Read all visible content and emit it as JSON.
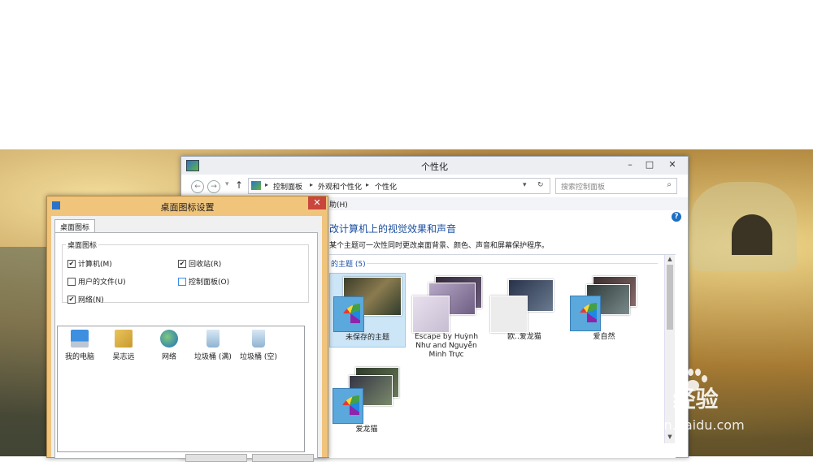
{
  "main_window": {
    "title": "个性化",
    "controls": [
      "–",
      "□",
      "✕"
    ],
    "nav": {
      "back": "←",
      "forward": "→",
      "recent": "▾",
      "up": "↑"
    },
    "breadcrumb": [
      "控制面板",
      "外观和个性化",
      "个性化"
    ],
    "breadcrumb_sep": "▸",
    "dropdown": "▾",
    "refresh": "↻",
    "search_placeholder": "搜索控制面板",
    "search_glyph": "⌕",
    "menu_help": "助(H)",
    "help_glyph": "?",
    "heading": "改计算机上的视觉效果和声音",
    "subtitle": "某个主题可一次性同时更改桌面背景、颜色、声音和屏幕保护程序。",
    "section": {
      "title": "的主题",
      "count": "(5)"
    },
    "scroll": {
      "up": "▲",
      "down": "▼"
    },
    "themes": [
      {
        "label": "未保存的主题",
        "selected": true
      },
      {
        "label": "Escape by Huỳnh Như and Nguyễn Minh Trực",
        "selected": false
      },
      {
        "label": "欧..爱龙猫",
        "selected": false
      },
      {
        "label": "爱自然",
        "selected": false
      },
      {
        "label": "爱龙猫",
        "selected": false
      }
    ]
  },
  "dialog": {
    "title": "桌面图标设置",
    "close": "✕",
    "tab": "桌面图标",
    "group_label": "桌面图标",
    "checkboxes": [
      {
        "label": "计算机(M)",
        "checked": true
      },
      {
        "label": "回收站(R)",
        "checked": true
      },
      {
        "label": "用户的文件(U)",
        "checked": false
      },
      {
        "label": "控制面板(O)",
        "checked": false
      },
      {
        "label": "网络(N)",
        "checked": true
      }
    ],
    "check_glyph": "✔",
    "icons": [
      "我的电脑",
      "吴志远",
      "网络",
      "垃圾桶 (满)",
      "垃圾桶 (空)"
    ]
  },
  "watermark": {
    "brand": "Bai  经验",
    "url": "jingyan.baidu.com"
  },
  "colors": {
    "dialog_title": "#f0c47b",
    "link_blue": "#1b4fa0",
    "selection": "#cde6f7",
    "close_red": "#c9463d"
  }
}
